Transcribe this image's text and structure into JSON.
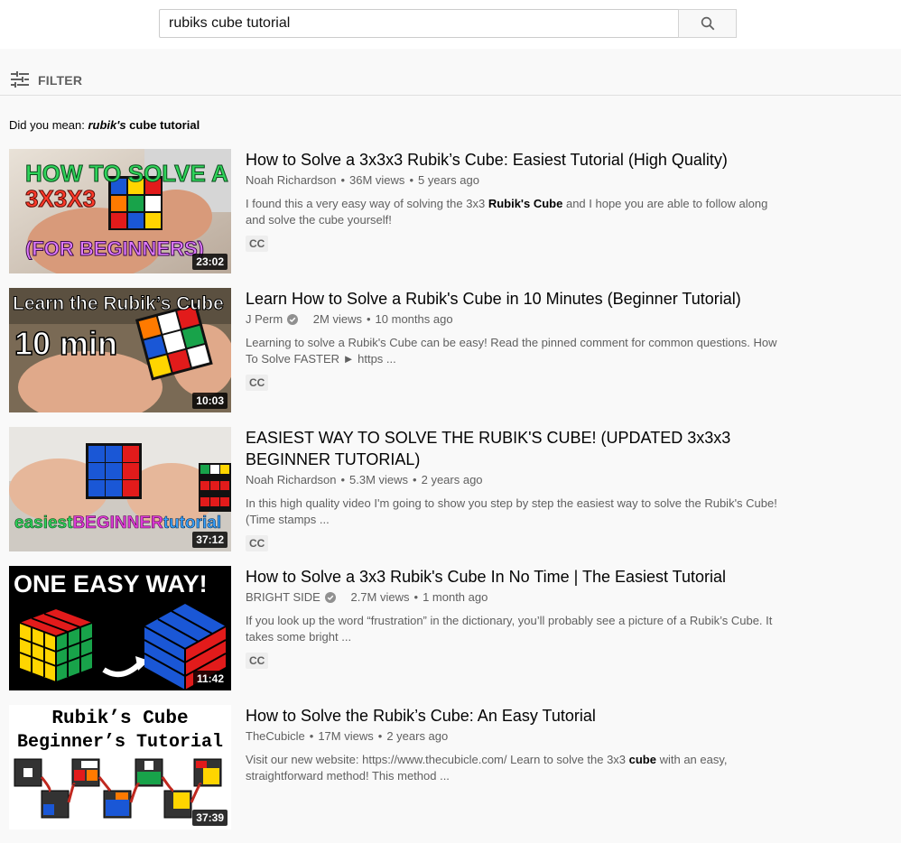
{
  "search": {
    "query": "rubiks cube tutorial",
    "placeholder": "Search"
  },
  "filter": {
    "label": "FILTER"
  },
  "correction": {
    "prefix": "Did you mean:",
    "suggest_italic": "rubik's",
    "suggest_rest": " cube tutorial"
  },
  "videos": [
    {
      "title": "How to Solve a 3x3x3 Rubik’s Cube: Easiest Tutorial (High Quality)",
      "channel": "Noah Richardson",
      "verified": false,
      "views": "36M views",
      "age": "5 years ago",
      "desc_before": "I found this a very easy way of solving the 3x3 ",
      "desc_bold": "Rubik's Cube",
      "desc_after": " and I hope you are able to follow along and solve the cube yourself!",
      "badge": "CC",
      "duration": "23:02",
      "thumb_text": [
        "HOW TO SOLVE A",
        "3X3X3",
        "(FOR BEGINNERS)"
      ]
    },
    {
      "title": "Learn How to Solve a Rubik's Cube in 10 Minutes (Beginner Tutorial)",
      "channel": "J Perm",
      "verified": true,
      "views": "2M views",
      "age": "10 months ago",
      "desc_before": "Learning to solve a Rubik's Cube can be easy! Read the pinned comment for common questions. How To Solve FASTER ► https ...",
      "desc_bold": "",
      "desc_after": "",
      "badge": "CC",
      "duration": "10:03",
      "thumb_text": [
        "Learn the Rubik’s Cube",
        "10 min"
      ]
    },
    {
      "title": "EASIEST WAY TO SOLVE THE RUBIK'S CUBE! (UPDATED 3x3x3 BEGINNER TUTORIAL)",
      "channel": "Noah Richardson",
      "verified": false,
      "views": "5.3M views",
      "age": "2 years ago",
      "desc_before": "In this high quality video I'm going to show you step by step the easiest way to solve the Rubik's Cube! (Time stamps ...",
      "desc_bold": "",
      "desc_after": "",
      "badge": "CC",
      "duration": "37:12",
      "thumb_text": [
        "easiest",
        "BEGINNER",
        "tutorial"
      ]
    },
    {
      "title": "How to Solve a 3x3 Rubik's Cube In No Time | The Easiest Tutorial",
      "channel": "BRIGHT SIDE",
      "verified": true,
      "views": "2.7M views",
      "age": "1 month ago",
      "desc_before": "If you look up the word “frustration” in the dictionary, you’ll probably see a picture of a Rubik’s Cube. It takes some bright ...",
      "desc_bold": "",
      "desc_after": "",
      "badge": "CC",
      "duration": "11:42",
      "thumb_text": [
        "ONE EASY WAY!"
      ]
    },
    {
      "title": "How to Solve the Rubik’s Cube: An Easy Tutorial",
      "channel": "TheCubicle",
      "verified": false,
      "views": "17M views",
      "age": "2 years ago",
      "desc_before": "Visit our new website: https://www.thecubicle.com/ Learn to solve the 3x3 ",
      "desc_bold": "cube",
      "desc_after": " with an easy, straightforward method! This method ...",
      "badge": "",
      "duration": "37:39",
      "thumb_text": [
        "Rubik’s Cube",
        "Beginner’s Tutorial"
      ]
    }
  ]
}
